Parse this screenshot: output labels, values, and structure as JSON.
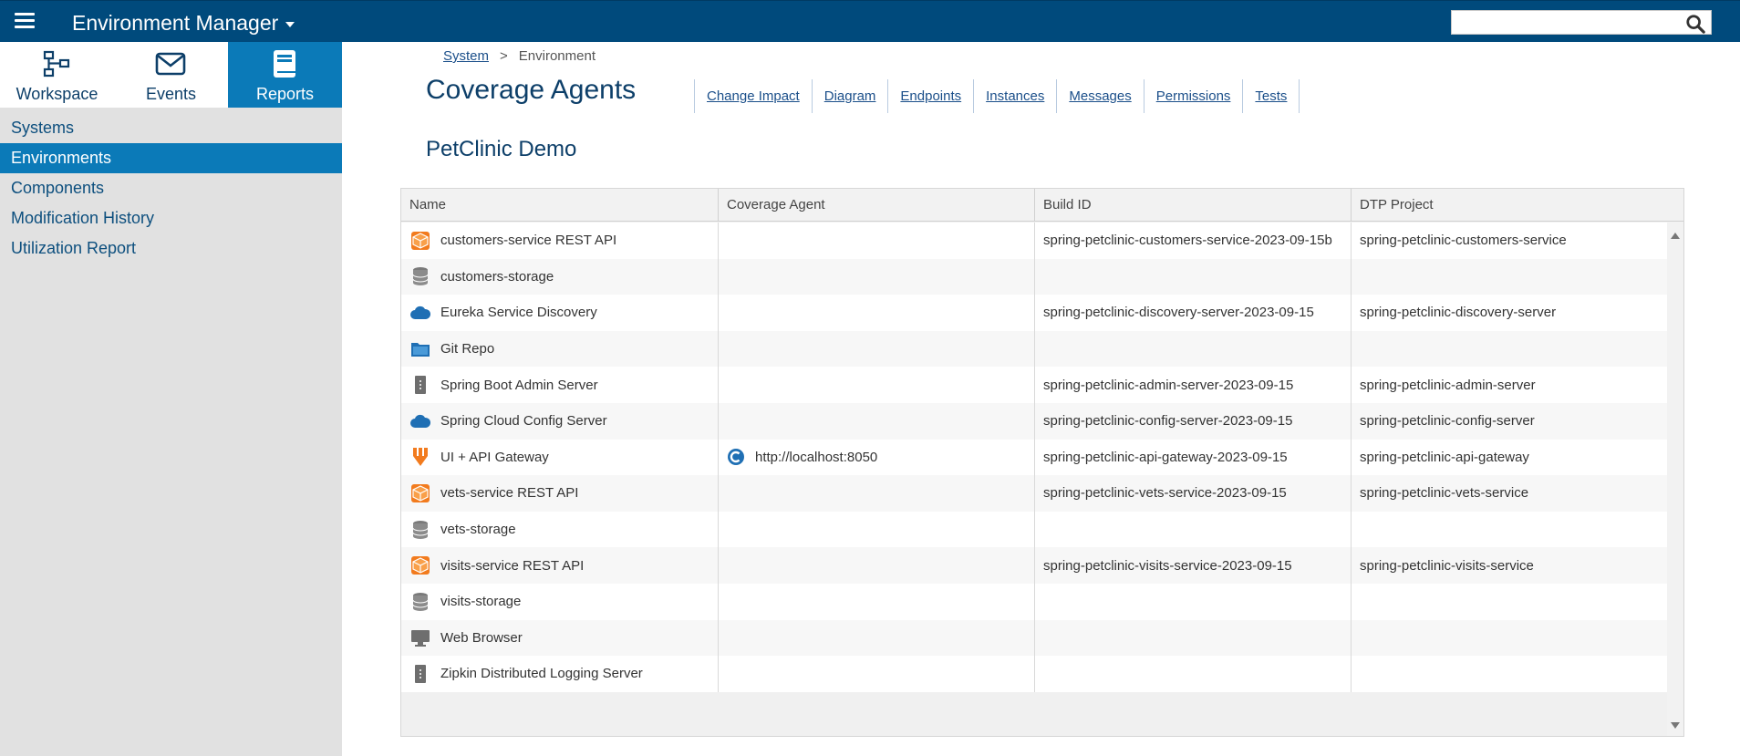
{
  "header": {
    "app_title": "Environment Manager",
    "search_placeholder": ""
  },
  "sidebar": {
    "tabs": [
      {
        "label": "Workspace",
        "icon": "workspace-icon"
      },
      {
        "label": "Events",
        "icon": "envelope-icon"
      },
      {
        "label": "Reports",
        "icon": "book-icon",
        "active": true
      }
    ],
    "links": [
      {
        "label": "Systems"
      },
      {
        "label": "Environments",
        "active": true
      },
      {
        "label": "Components"
      },
      {
        "label": "Modification History"
      },
      {
        "label": "Utilization Report"
      }
    ]
  },
  "main": {
    "breadcrumb": {
      "parent": "System",
      "separator": ">",
      "current": "Environment"
    },
    "title": "Coverage Agents",
    "subtabs": [
      "Change Impact",
      "Diagram",
      "Endpoints",
      "Instances",
      "Messages",
      "Permissions",
      "Tests"
    ],
    "environment_name": "PetClinic Demo",
    "table": {
      "columns": [
        "Name",
        "Coverage Agent",
        "Build ID",
        "DTP Project"
      ],
      "rows": [
        {
          "icon": "api-cube-icon",
          "name": "customers-service REST API",
          "agent": "",
          "build": "spring-petclinic-customers-service-2023-09-15b",
          "dtp": "spring-petclinic-customers-service"
        },
        {
          "icon": "database-icon",
          "name": "customers-storage",
          "agent": "",
          "build": "",
          "dtp": ""
        },
        {
          "icon": "cloud-icon",
          "name": "Eureka Service Discovery",
          "agent": "",
          "build": "spring-petclinic-discovery-server-2023-09-15",
          "dtp": "spring-petclinic-discovery-server"
        },
        {
          "icon": "folder-icon",
          "name": "Git Repo",
          "agent": "",
          "build": "",
          "dtp": ""
        },
        {
          "icon": "server-icon",
          "name": "Spring Boot Admin Server",
          "agent": "",
          "build": "spring-petclinic-admin-server-2023-09-15",
          "dtp": "spring-petclinic-admin-server"
        },
        {
          "icon": "cloud-icon",
          "name": "Spring Cloud Config Server",
          "agent": "",
          "build": "spring-petclinic-config-server-2023-09-15",
          "dtp": "spring-petclinic-config-server"
        },
        {
          "icon": "gateway-icon",
          "name": "UI + API Gateway",
          "agent": "http://localhost:8050",
          "build": "spring-petclinic-api-gateway-2023-09-15",
          "dtp": "spring-petclinic-api-gateway"
        },
        {
          "icon": "api-cube-icon",
          "name": "vets-service REST API",
          "agent": "",
          "build": "spring-petclinic-vets-service-2023-09-15",
          "dtp": "spring-petclinic-vets-service"
        },
        {
          "icon": "database-icon",
          "name": "vets-storage",
          "agent": "",
          "build": "",
          "dtp": ""
        },
        {
          "icon": "api-cube-icon",
          "name": "visits-service REST API",
          "agent": "",
          "build": "spring-petclinic-visits-service-2023-09-15",
          "dtp": "spring-petclinic-visits-service"
        },
        {
          "icon": "database-icon",
          "name": "visits-storage",
          "agent": "",
          "build": "",
          "dtp": ""
        },
        {
          "icon": "monitor-icon",
          "name": "Web Browser",
          "agent": "",
          "build": "",
          "dtp": ""
        },
        {
          "icon": "server-icon",
          "name": "Zipkin Distributed Logging Server",
          "agent": "",
          "build": "",
          "dtp": ""
        }
      ]
    }
  },
  "colors": {
    "header_bg": "#004a7c",
    "accent": "#0b7ab8",
    "sidebar_bg": "#e1e1e1",
    "title_text": "#0d3f69",
    "api_orange": "#f27b1e",
    "cloud_blue": "#1f6fb4"
  }
}
